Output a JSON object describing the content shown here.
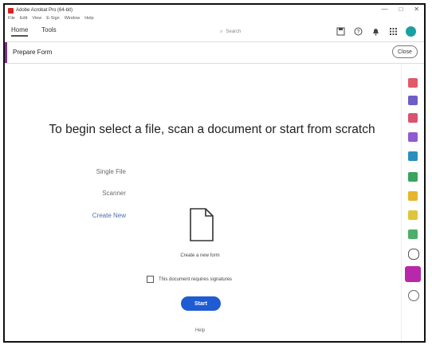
{
  "app": {
    "title": "Adobe Acrobat Pro (64-bit)",
    "menu": [
      "File",
      "Edit",
      "View",
      "E-Sign",
      "Window",
      "Help"
    ],
    "window_controls": [
      "—",
      "□",
      "✕"
    ]
  },
  "tabs": {
    "home": "Home",
    "tools": "Tools"
  },
  "search": {
    "placeholder": "Search"
  },
  "toolbar_icons": [
    "save-icon",
    "help-icon",
    "bell-icon",
    "apps-grid-icon"
  ],
  "form_bar": {
    "title": "Prepare Form",
    "close": "Close"
  },
  "main": {
    "heading": "To begin select a file, scan a document or start from scratch",
    "options": {
      "single_file": "Single File",
      "scanner": "Scanner",
      "create_new": "Create New"
    },
    "create_label": "Create a new form",
    "checkbox_label": "This document requires signatures",
    "start": "Start",
    "help": "Help"
  },
  "rail_icons": [
    "export-pdf-icon",
    "combine-icon",
    "edit-pdf-icon",
    "fill-sign-icon",
    "export-icon",
    "organize-icon",
    "comment-icon",
    "redact-icon",
    "protect-icon",
    "shield-icon",
    "prepare-form-icon",
    "share-icon"
  ],
  "colors": {
    "accent_purple": "#7b2e8b",
    "selected_rail": "#b829a9",
    "start_blue": "#1f5bd2",
    "link_blue": "#4a6fb3"
  }
}
